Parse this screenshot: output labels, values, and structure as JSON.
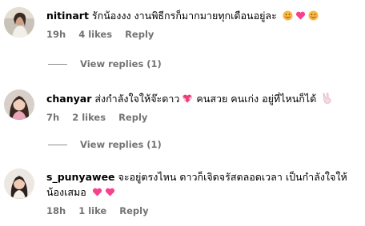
{
  "comments": [
    {
      "username": "nitinart",
      "text": "รักน้องงง งานพิธีกรก็มากมายทุกเดือนอยู่ละ",
      "emojis": [
        "smiling-face-icon",
        "pink-heart-icon",
        "smiling-face-icon"
      ],
      "time": "19h",
      "likes": "4 likes",
      "reply": "Reply",
      "view_replies": "View replies (1)"
    },
    {
      "username": "chanyar",
      "text": "ส่งกำลังใจให้จ๊ะดาว",
      "text_after_heart": "คนสวย คนเก่ง อยู่ที่ไหนก็ได้",
      "emojis": [
        "heart-with-ribbon-icon",
        "victory-hand-icon"
      ],
      "time": "7h",
      "likes": "2 likes",
      "reply": "Reply",
      "view_replies": "View replies (1)"
    },
    {
      "username": "s_punyawee",
      "text": "จะอยู่ตรงไหน ดาวก็เจิดจรัสตลอดเวลา เป็นกำลังใจให้น้องเสมอ",
      "emojis": [
        "pink-heart-icon",
        "pink-heart-icon"
      ],
      "time": "18h",
      "likes": "1 like",
      "reply": "Reply"
    }
  ],
  "colors": {
    "meta": "#737373",
    "heart": "#f7418f",
    "face": "#f6b93b"
  }
}
